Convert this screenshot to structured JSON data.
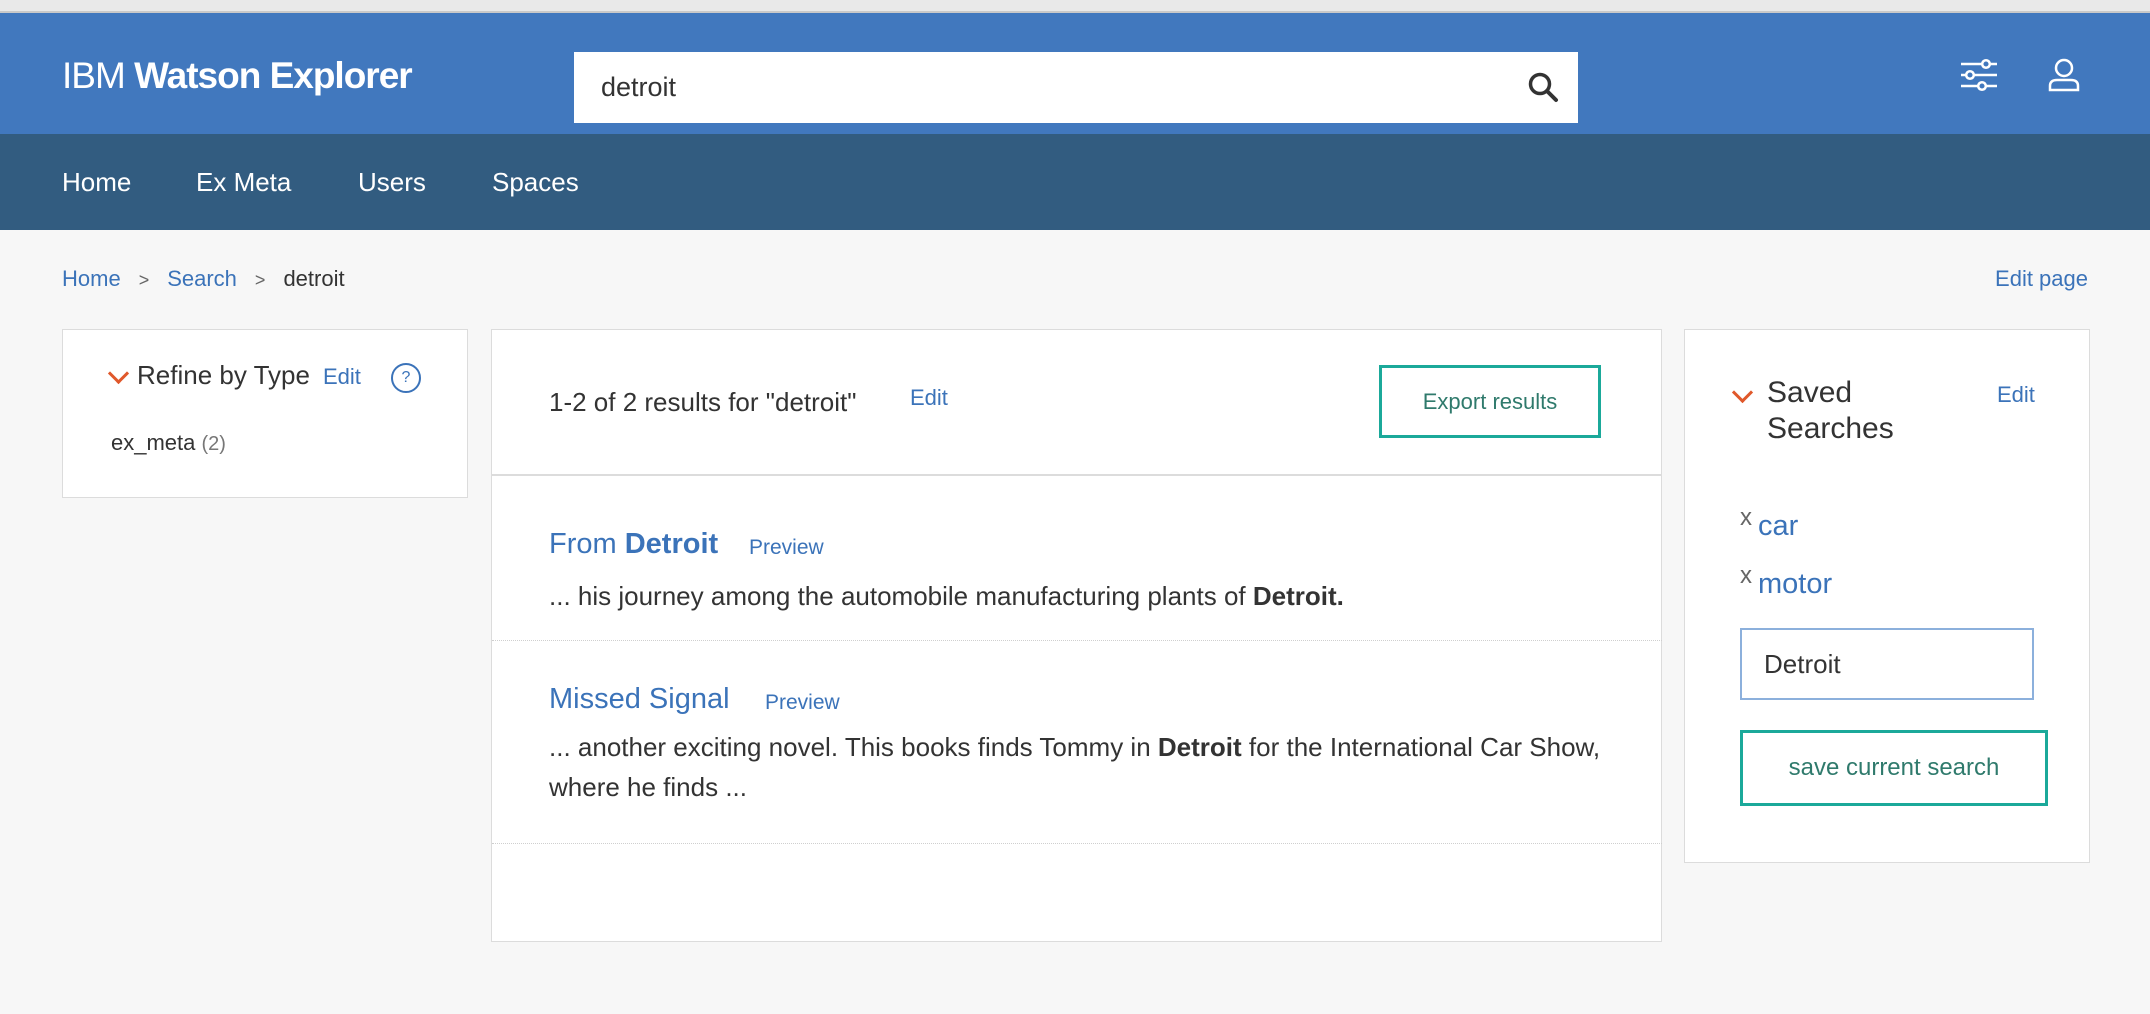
{
  "header": {
    "logo_ibm": "IBM",
    "logo_product": "Watson Explorer",
    "search_value": "detroit",
    "search_icon": "search-icon",
    "settings_icon": "sliders-icon",
    "user_icon": "user-icon"
  },
  "nav": {
    "items": [
      {
        "label": "Home"
      },
      {
        "label": "Ex Meta"
      },
      {
        "label": "Users"
      },
      {
        "label": "Spaces"
      }
    ]
  },
  "breadcrumb": {
    "home": "Home",
    "sep1": ">",
    "search": "Search",
    "sep2": ">",
    "current": "detroit"
  },
  "edit_page_label": "Edit page",
  "refine": {
    "title": "Refine by Type",
    "edit_label": "Edit",
    "help_label": "?",
    "facets": [
      {
        "label": "ex_meta",
        "count": "(2)"
      }
    ]
  },
  "results": {
    "summary": "1-2 of 2 results for \"detroit\"",
    "edit_label": "Edit",
    "export_label": "Export results",
    "items": [
      {
        "title_prefix": "From ",
        "title_highlight": "Detroit",
        "preview_label": "Preview",
        "snippet_before": "... his journey among the automobile manufacturing plants of ",
        "snippet_highlight": "Detroit.",
        "snippet_after": ""
      },
      {
        "title_prefix": "Missed Signal",
        "title_highlight": "",
        "preview_label": "Preview",
        "snippet_before": "... another exciting novel. This books finds Tommy in ",
        "snippet_highlight": "Detroit",
        "snippet_after": " for the International Car Show, where he finds ..."
      }
    ]
  },
  "saved": {
    "title": "Saved Searches",
    "edit_label": "Edit",
    "remove_label": "x",
    "items": [
      {
        "label": "car"
      },
      {
        "label": "motor"
      }
    ],
    "input_value": "Detroit",
    "save_label": "save current search"
  },
  "colors": {
    "header": "#4178be",
    "nav": "#325c80",
    "link": "#3b73b9",
    "accent_border": "#1ba99a",
    "chevron": "#e0582b"
  }
}
